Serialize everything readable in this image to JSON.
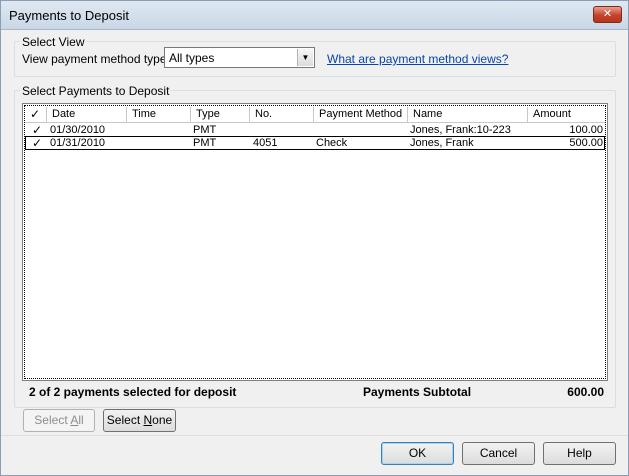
{
  "window": {
    "title": "Payments to Deposit",
    "close_glyph": "✕"
  },
  "select_view": {
    "group_label": "Select View",
    "field_label": "View payment method type",
    "combo_value": "All types",
    "link_text": "What are payment method views?"
  },
  "payments": {
    "group_label": "Select Payments to Deposit",
    "columns": [
      "✓",
      "Date",
      "Time",
      "Type",
      "No.",
      "Payment Method",
      "Name",
      "Amount"
    ],
    "rows": [
      {
        "check": "✓",
        "date": "01/30/2010",
        "time": "",
        "type": "PMT",
        "no": "",
        "method": "",
        "name": "Jones, Frank:10-223",
        "amount": "100.00"
      },
      {
        "check": "✓",
        "date": "01/31/2010",
        "time": "",
        "type": "PMT",
        "no": "4051",
        "method": "Check",
        "name": "Jones, Frank",
        "amount": "500.00"
      }
    ]
  },
  "summary": {
    "selected_text": "2 of 2 payments selected for deposit",
    "subtotal_label": "Payments Subtotal",
    "subtotal_value": "600.00"
  },
  "buttons": {
    "select_all": {
      "pre": "Select ",
      "key": "A",
      "post": "ll"
    },
    "select_none": {
      "pre": "Select ",
      "key": "N",
      "post": "one"
    },
    "ok": "OK",
    "cancel": "Cancel",
    "help": "Help"
  }
}
